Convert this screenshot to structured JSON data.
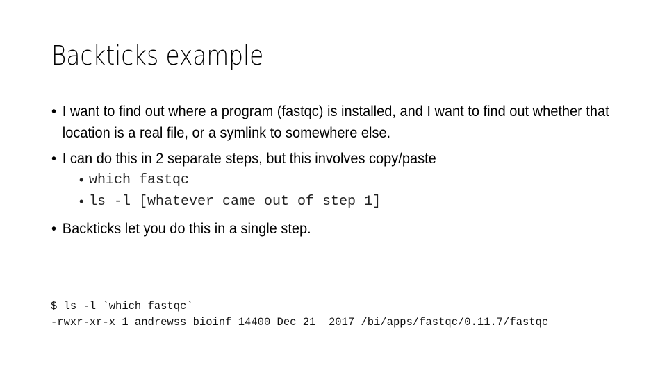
{
  "slide": {
    "title": "Backticks example",
    "bullets": [
      {
        "symbol": "•",
        "text": "I want to find out where a program (fastqc) is installed, and I want to find out whether that location is a real file, or a symlink to somewhere else."
      },
      {
        "symbol": "•",
        "text": "I can do this in 2 separate steps, but this involves copy/paste",
        "sub_items": [
          {
            "symbol": "•",
            "text": "which fastqc"
          },
          {
            "symbol": "•",
            "text": "ls -l [whatever came out of step 1]"
          }
        ]
      },
      {
        "symbol": "•",
        "text": "Backticks let you do this in a single step."
      }
    ],
    "terminal": {
      "command_line": "$ ls -l `which fastqc`",
      "output_line": "-rwxr-xr-x 1 andrewss bioinf 14400 Dec 21  2017 /bi/apps/fastqc/0.11.7/fastqc"
    }
  }
}
